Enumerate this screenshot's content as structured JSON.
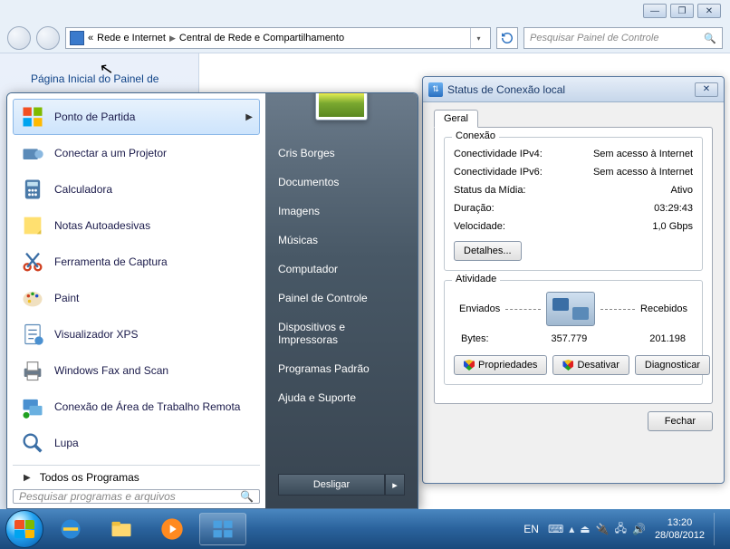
{
  "window_controls": {
    "min": "—",
    "max": "❐",
    "close": "✕"
  },
  "breadcrumb": {
    "root": "«",
    "a": "Rede e Internet",
    "b": "Central de Rede e Compartilhamento"
  },
  "search_placeholder": "Pesquisar Painel de Controle",
  "sidebar_title": "Página Inicial do Painel de",
  "start_menu": {
    "items": [
      {
        "label": "Ponto de Partida",
        "arrow": true,
        "icon": "start"
      },
      {
        "label": "Conectar a um Projetor",
        "icon": "projector"
      },
      {
        "label": "Calculadora",
        "icon": "calc"
      },
      {
        "label": "Notas Autoadesivas",
        "icon": "notes"
      },
      {
        "label": "Ferramenta de Captura",
        "icon": "snip"
      },
      {
        "label": "Paint",
        "icon": "paint"
      },
      {
        "label": "Visualizador XPS",
        "icon": "xps"
      },
      {
        "label": "Windows Fax and Scan",
        "icon": "fax"
      },
      {
        "label": "Conexão de Área de Trabalho Remota",
        "icon": "rdp"
      },
      {
        "label": "Lupa",
        "icon": "mag"
      }
    ],
    "all_programs": "Todos os Programas",
    "search_placeholder": "Pesquisar programas e arquivos",
    "right": [
      "Cris Borges",
      "Documentos",
      "Imagens",
      "Músicas",
      "Computador",
      "Painel de Controle",
      "Dispositivos e Impressoras",
      "Programas Padrão",
      "Ajuda e Suporte"
    ],
    "shutdown": "Desligar"
  },
  "status": {
    "title": "Status de Conexão local",
    "tab": "Geral",
    "group_conn": "Conexão",
    "rows": [
      {
        "k": "Conectividade IPv4:",
        "v": "Sem acesso à Internet"
      },
      {
        "k": "Conectividade IPv6:",
        "v": "Sem acesso à Internet"
      },
      {
        "k": "Status da Mídia:",
        "v": "Ativo"
      },
      {
        "k": "Duração:",
        "v": "03:29:43"
      },
      {
        "k": "Velocidade:",
        "v": "1,0 Gbps"
      }
    ],
    "details": "Detalhes...",
    "group_act": "Atividade",
    "sent": "Enviados",
    "received": "Recebidos",
    "bytes_label": "Bytes:",
    "bytes_sent": "357.779",
    "bytes_recv": "201.198",
    "buttons": {
      "props": "Propriedades",
      "disable": "Desativar",
      "diag": "Diagnosticar"
    },
    "close": "Fechar"
  },
  "taskbar": {
    "lang": "EN",
    "time": "13:20",
    "date": "28/08/2012"
  }
}
